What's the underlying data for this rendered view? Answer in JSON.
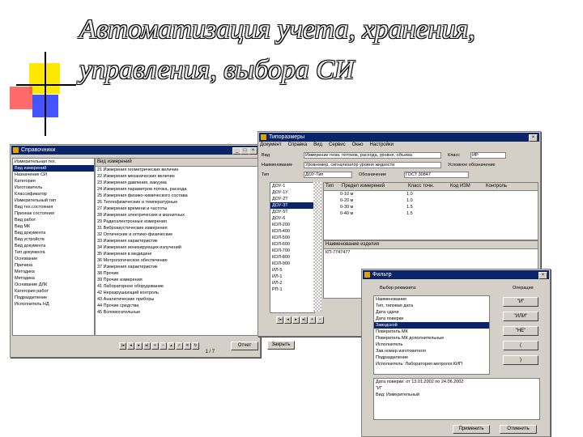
{
  "slide": {
    "title_line1": "Автоматизация учета, хранения,",
    "title_line2": "управления, выбора СИ"
  },
  "win1": {
    "title": "Справочники",
    "left_tree": [
      "Измерительная тех.",
      "Вид измерений",
      "Назначение СИ",
      "Категория",
      "Изготовитель",
      "Классификатор",
      "Измерительный тип",
      "Вид тех.состояния",
      "Признак состояния",
      "Вид работ",
      "Вид МК",
      "Вид документа",
      "Вид устройств",
      "Вид документа",
      "Тип документа",
      "Основание",
      "Причина",
      "Методика",
      "Методика",
      "Основание ДЛК",
      "Категория работ",
      "Подразделение",
      "Исполнитель НД"
    ],
    "list_header": "Вид измерений",
    "list_items": [
      "21 Измерения геометрических величин",
      "22 Измерения механических величин",
      "23 Измерения давления, вакуума",
      "24 Измерения параметров потока, расхода",
      "25 Измерения физико-химического состава",
      "26 Теплофизические и температурные",
      "27 Измерения времени и частоты",
      "28 Измерения электрических и магнитных",
      "29 Радиоэлектронные измерения",
      "31 Виброакустические измерения",
      "32 Оптические и оптико-физические",
      "33 Измерения характеристик",
      "34 Измерения ионизирующих излучений",
      "35 Измерения в медицине",
      "36 Метрологическое обеспечение",
      "37 Измерения характеристик",
      "38 Прочие",
      "39 Прочие измерения",
      "41 Лабораторное оборудование",
      "42 Неразрушающий контроль",
      "43 Аналитические приборы",
      "44 Прочие средства",
      "45 Вспомогательные"
    ],
    "nav_count": "1 / 7",
    "btn_report": "Отчет",
    "btn_close": "Закрыть"
  },
  "win2": {
    "title": "Типоразмеры",
    "menu": [
      "Документ",
      "Справка",
      "Вид",
      "Сервис",
      "Окно",
      "Настройки"
    ],
    "label_vid": "Вид",
    "label_naim": "Наименование",
    "label_tip": "Тип",
    "label_oboznach": "Обозначение",
    "field_vid": "Измерение геом. потоков, расхода, уровня, объема",
    "field_naim": "Уровнемер, сигнализатор уровня жидкости",
    "field_tip": "ДОУ-Тип",
    "field_oboznach": "ГОСТ 30847",
    "label_kl": "Класс",
    "field_kl": "ИР",
    "label_um": "Условное обозначение",
    "table_header": [
      "Тип",
      "Предел измерений",
      "Класс точн.",
      "Код ИЗМ",
      "Контроль"
    ],
    "types": [
      "ДОУ-1",
      "ДОУ-1У",
      "ДОУ-2Т",
      "ДОУ-3Т",
      "ДОУ-5Т",
      "ДОУ-6",
      "КОЛ-200",
      "КОЛ-400",
      "КОЛ-500",
      "КОЛ-600",
      "КОЛ-700",
      "КОЛ-800",
      "КОЛ-900",
      "ИЛ-5",
      "ИЛ-1",
      "ИЛ-2",
      "РП-1"
    ],
    "selected_type": "ДОУ-3Т",
    "rows": [
      [
        "0-10 м",
        "1.0"
      ],
      [
        "0-20 м",
        "1.0"
      ],
      [
        "0-30 м",
        "1.5"
      ],
      [
        "0-40 м",
        "1.5"
      ]
    ],
    "sub_header": "Наименование изделия",
    "sub_row": "КП-7747477"
  },
  "win3": {
    "title": "Фильтр",
    "choose_label": "Выбор реквизита:",
    "op_label": "Операция",
    "fields": [
      "Наименование",
      "Тип, типовая дата",
      "Дата сдачи",
      "Дата поверки",
      "Заводской",
      "Поверитель МК",
      "Поверитель МК дополнительные",
      "Исполнитель",
      "Зав.номер изготовителя",
      "Подразделение",
      "Исполнитель: Лаборатория метролог.КИП"
    ],
    "selected_field": "Заводской",
    "op_buttons": [
      "\"И\"",
      "\"ИЛИ\"",
      "\"НЕ\"",
      "(",
      ")"
    ],
    "text_lines": [
      "Дата поверки: от 13.01.2002 по 24.06.2002",
      "\"И\"",
      "Вид: Измерительный"
    ],
    "btn_apply": "Применить",
    "btn_cancel": "Отменить"
  }
}
